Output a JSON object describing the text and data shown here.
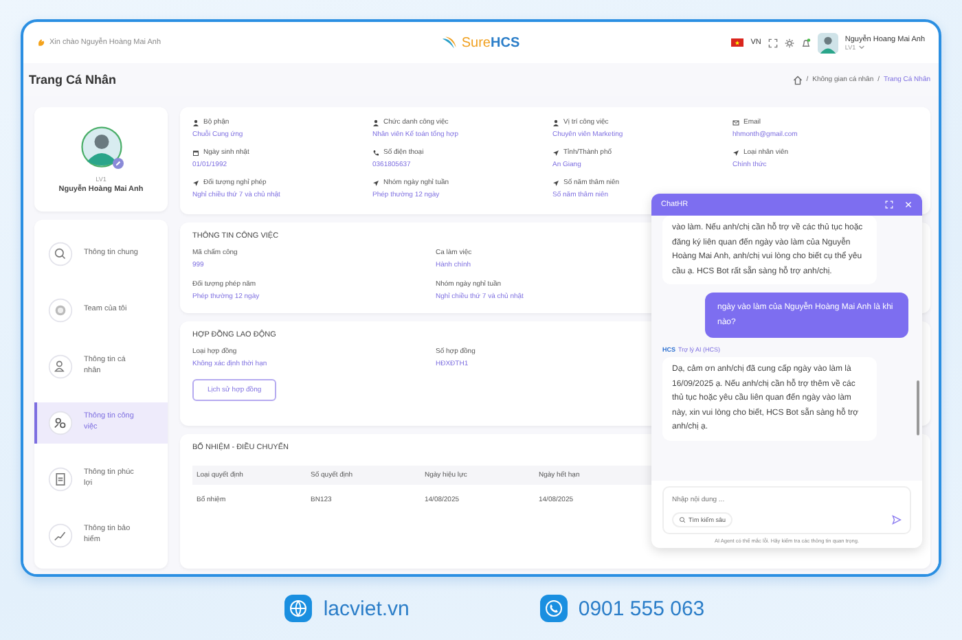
{
  "header": {
    "greeting": "Xin chào Nguyễn Hoàng Mai Anh",
    "logo_first": "Sure",
    "logo_second": "HCS",
    "language": "VN",
    "user_name": "Nguyễn Hoang Mai Anh",
    "user_rank": "LV1"
  },
  "page": {
    "title": "Trang Cá Nhân",
    "separator": "/",
    "breadcrumb": [
      {
        "label": "Không gian cá nhân",
        "selected": false
      },
      {
        "label": "Trang Cá Nhân",
        "selected": true
      }
    ]
  },
  "profile": {
    "rank": "LV1",
    "name": "Nguyễn Hoàng Mai Anh"
  },
  "nav": [
    {
      "label": "Thông tin chung",
      "kind": "search",
      "selected": false
    },
    {
      "label": "Team của tôi",
      "kind": "team",
      "selected": false
    },
    {
      "label": "Thông tin cá nhân",
      "kind": "person",
      "selected": false
    },
    {
      "label": "Thông tin công việc",
      "kind": "work",
      "selected": true
    },
    {
      "label": "Thông tin phúc lợi",
      "kind": "document",
      "selected": false
    },
    {
      "label": "Thông tin bảo hiểm",
      "kind": "chart",
      "selected": false
    }
  ],
  "info_fields": [
    {
      "kind": "person",
      "label": "Bộ phận",
      "value": "Chuỗi Cung ứng"
    },
    {
      "kind": "person",
      "label": "Chức danh công việc",
      "value": "Nhân viên Kế toán tổng hợp"
    },
    {
      "kind": "person",
      "label": "Vị trí công việc",
      "value": "Chuyên viên Marketing"
    },
    {
      "kind": "mail",
      "label": "Email",
      "value": "hhmonth@gmail.com"
    },
    {
      "kind": "calendar",
      "label": "Ngày sinh nhật",
      "value": "01/01/1992"
    },
    {
      "kind": "phone",
      "label": "Số điện thoại",
      "value": "0361805637"
    },
    {
      "kind": "pin",
      "label": "Tỉnh/Thành phố",
      "value": "An Giang"
    },
    {
      "kind": "pin",
      "label": "Loại nhân viên",
      "value": "Chính thức"
    },
    {
      "kind": "pin",
      "label": "Đối tượng nghỉ phép",
      "value": "Nghỉ chiều thứ 7 và chủ nhật"
    },
    {
      "kind": "pin",
      "label": "Nhóm ngày nghỉ tuần",
      "value": "Phép thường 12 ngày"
    },
    {
      "kind": "pin",
      "label": "Số năm thâm niên",
      "value": "Số năm thâm niên"
    }
  ],
  "work_info": {
    "title": "THÔNG TIN CÔNG VIỆC",
    "fields": [
      {
        "label": "Mã chấm công",
        "value": "999"
      },
      {
        "label": "Ca làm việc",
        "value": "Hành chính"
      },
      {
        "label": "Đối tượng phép năm",
        "value": "Phép thường 12 ngày"
      },
      {
        "label": "Nhóm ngày nghỉ tuần",
        "value": "Nghỉ chiều thứ 7 và chủ nhật"
      }
    ]
  },
  "contract": {
    "title": "HỢP ĐỒNG LAO ĐỘNG",
    "fields": [
      {
        "label": "Loại hợp đồng",
        "value": "Không xác định thời hạn"
      },
      {
        "label": "Số hợp đồng",
        "value": "HĐXĐTH1"
      }
    ],
    "button": "Lịch sử hợp đồng"
  },
  "appointments": {
    "title": "BỔ NHIỆM - ĐIỀU CHUYỂN",
    "columns": [
      "Loại quyết định",
      "Số quyết định",
      "Ngày hiệu lực",
      "Ngày hết hạn"
    ],
    "rows": [
      [
        "Bổ nhiệm",
        "BN123",
        "14/08/2025",
        "14/08/2025"
      ]
    ]
  },
  "chat": {
    "title": "ChatHR",
    "messages": [
      {
        "kind": "bot",
        "text": "vào làm. Nếu anh/chị cần hỗ trợ về các thủ tục hoặc đăng ký liên quan đến ngày vào làm của Nguyễn Hoàng Mai Anh, anh/chị vui lòng cho biết cụ thể yêu cầu ạ. HCS Bot rất sẵn sàng hỗ trợ anh/chị."
      },
      {
        "kind": "user",
        "text": "ngày vào làm của Nguyễn Hoàng Mai Anh là khi nào?"
      },
      {
        "kind": "bot",
        "badge": "HCS",
        "sender": "Trợ lý AI (HCS)",
        "text": "Dạ, cảm ơn anh/chị đã cung cấp ngày vào làm là 16/09/2025 ạ. Nếu anh/chị cần hỗ trợ thêm về các thủ tục hoặc yêu cầu liên quan đến ngày vào làm này, xin vui lòng cho biết, HCS Bot sẵn sàng hỗ trợ anh/chị ạ."
      }
    ],
    "input_placeholder": "Nhập nội dung ...",
    "deep_search": "Tìm kiếm sâu",
    "disclaimer": "AI Agent có thể mắc lỗi. Hãy kiểm tra các thông tin quan trọng."
  },
  "footer": {
    "website": "lacviet.vn",
    "phone": "0901 555 063"
  }
}
